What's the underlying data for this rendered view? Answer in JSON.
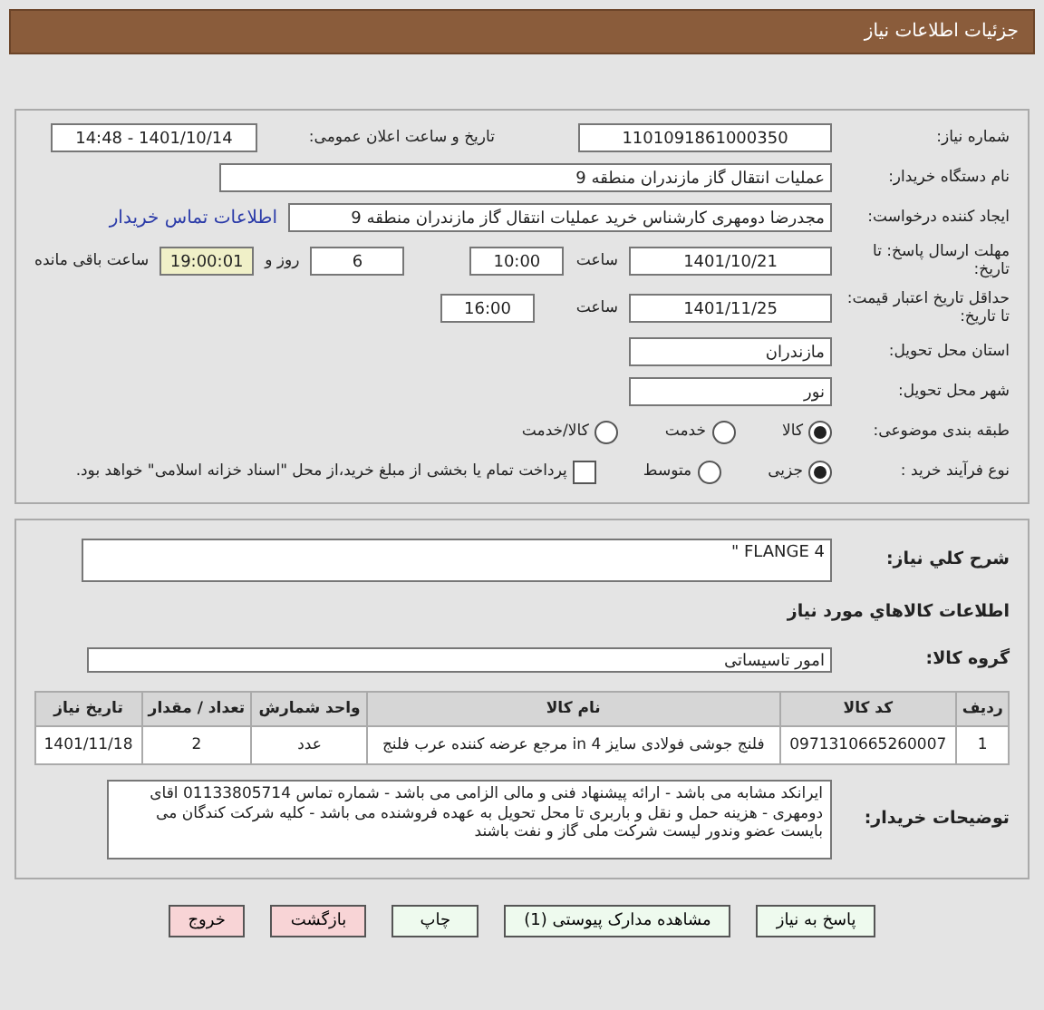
{
  "header": {
    "title": "جزئیات اطلاعات نیاز"
  },
  "info": {
    "need_number": {
      "label": "شماره نیاز:",
      "value": "1101091861000350"
    },
    "announce": {
      "label": "تاریخ و ساعت اعلان عمومی:",
      "value": "1401/10/14 - 14:48"
    },
    "buyer": {
      "label": "نام دستگاه خریدار:",
      "value": "عملیات انتقال گاز مازندران منطقه 9"
    },
    "creator": {
      "label": "ایجاد کننده درخواست:",
      "value": "مجدرضا دومهری کارشناس خرید عملیات انتقال گاز مازندران منطقه 9",
      "link": "اطلاعات تماس خریدار"
    },
    "deadline": {
      "label": "مهلت ارسال پاسخ: تا تاریخ:",
      "date": "1401/10/21",
      "time_label": "ساعت",
      "time": "10:00",
      "days": "6",
      "days_label": "روز و",
      "remaining": "19:00:01",
      "remaining_label": "ساعت باقی مانده"
    },
    "validity": {
      "label": "حداقل تاریخ اعتبار قیمت: تا تاریخ:",
      "date": "1401/11/25",
      "time_label": "ساعت",
      "time": "16:00"
    },
    "province": {
      "label": "استان محل تحویل:",
      "value": "مازندران"
    },
    "city": {
      "label": "شهر محل تحویل:",
      "value": "نور"
    },
    "category": {
      "label": "طبقه بندی موضوعی:",
      "options": [
        {
          "label": "کالا",
          "selected": true
        },
        {
          "label": "خدمت",
          "selected": false
        },
        {
          "label": "کالا/خدمت",
          "selected": false
        }
      ]
    },
    "process": {
      "label": "نوع فرآیند خرید :",
      "options": [
        {
          "label": "جزیی",
          "selected": true
        },
        {
          "label": "متوسط",
          "selected": false
        }
      ],
      "payment": {
        "label": "پرداخت تمام یا بخشی از مبلغ خرید،از محل \"اسناد خزانه اسلامی\" خواهد بود.",
        "checked": false
      }
    }
  },
  "needs": {
    "summary_label": "شرح کلي نياز:",
    "summary": "FLANGE 4 \"",
    "goods_heading": "اطلاعات کالاهاي مورد نياز",
    "group_label": "گروه کالا:",
    "group": "امور تاسیساتی",
    "table": {
      "columns": [
        "ردیف",
        "کد کالا",
        "نام کالا",
        "واحد شمارش",
        "تعداد / مقدار",
        "تاریخ نیاز"
      ],
      "rows": [
        [
          "1",
          "0971310665260007",
          "فلنج جوشی فولادی سایز 4 in مرجع عرضه کننده عرب فلنج",
          "عدد",
          "2",
          "1401/11/18"
        ]
      ]
    },
    "notes_label": "توضیحات خریدار:",
    "notes": "ایرانکد مشابه می باشد - ارائه پیشنهاد فنی  و مالی الزامی می باشد - شماره تماس 01133805714 اقای دومهری  - هزینه حمل و نقل و باربری تا محل تحویل به عهده فروشنده می باشد - کلیه شرکت کندگان می بایست عضو وندور لیست شرکت ملی گاز و نفت باشند"
  },
  "buttons": [
    {
      "label": "پاسخ به نیاز",
      "kind": "normal"
    },
    {
      "label": "مشاهده مدارک پیوستی (1)",
      "kind": "normal"
    },
    {
      "label": "چاپ",
      "kind": "normal"
    },
    {
      "label": "بازگشت",
      "kind": "danger"
    },
    {
      "label": "خروج",
      "kind": "danger"
    }
  ]
}
